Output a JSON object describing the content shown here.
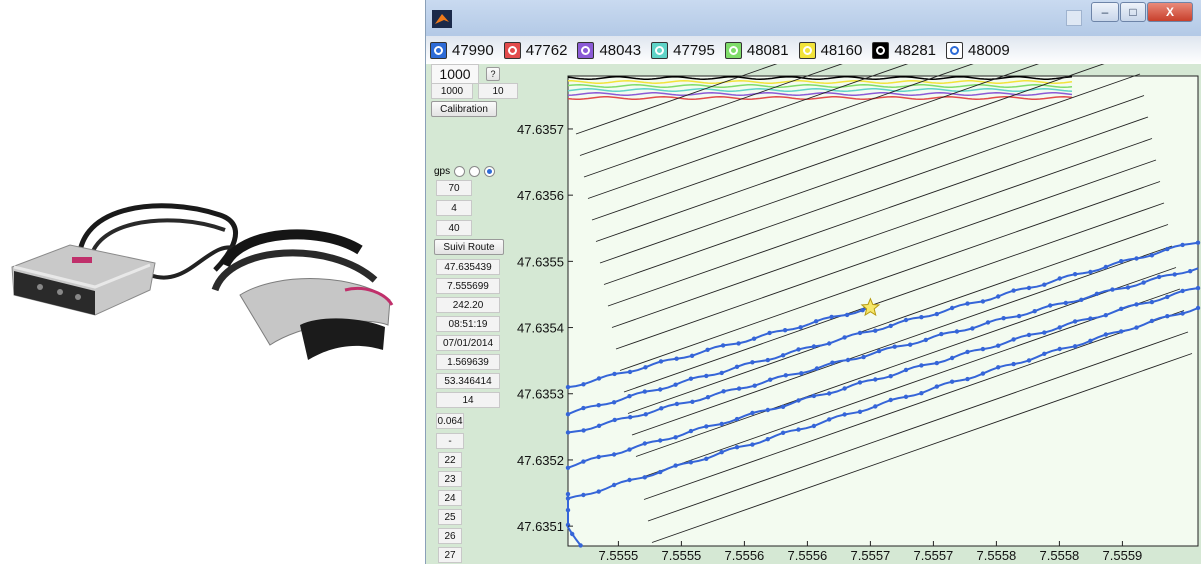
{
  "window": {
    "title": "",
    "buttons": {
      "minimize": "–",
      "maximize": "□",
      "close": "X"
    }
  },
  "legend": [
    {
      "label": "47990",
      "color": "#2d6bd6"
    },
    {
      "label": "47762",
      "color": "#e24b4b"
    },
    {
      "label": "48043",
      "color": "#8b5bd6"
    },
    {
      "label": "47795",
      "color": "#5fd3c7"
    },
    {
      "label": "48081",
      "color": "#7fdc6a"
    },
    {
      "label": "48160",
      "color": "#f2e33a"
    },
    {
      "label": "48281",
      "color": "#000000"
    },
    {
      "label": "48009",
      "color": "#ffffff"
    }
  ],
  "panel": {
    "rate_big": "1000",
    "help": "?",
    "rate": "1000",
    "step": "10",
    "calibration": "Calibration",
    "gps_label": "gps",
    "gps_selected_index": 2,
    "v70": "70",
    "v4": "4",
    "v40": "40",
    "suivi_route": "Suivi Route",
    "values": [
      "47.635439",
      "7.555699",
      "242.20",
      "08:51:19",
      "07/01/2014",
      "1.569639",
      "53.346414",
      "14"
    ],
    "v0064": "0.064",
    "dash": "-",
    "indices": [
      "22",
      "23",
      "24",
      "25",
      "26",
      "27"
    ]
  },
  "chart_data": {
    "type": "line",
    "xlim": [
      7.55543,
      7.55593
    ],
    "ylim": [
      47.63507,
      47.63578
    ],
    "x_ticks": [
      "7.5555",
      "7.5555",
      "7.5556",
      "7.5556",
      "7.5557",
      "7.5557",
      "7.5558",
      "7.5558",
      "7.5559"
    ],
    "x_tick_values": [
      7.55547,
      7.55552,
      7.55557,
      7.55562,
      7.55567,
      7.55572,
      7.55577,
      7.55582,
      7.55587
    ],
    "y_ticks": [
      "47.6351",
      "47.6352",
      "47.6353",
      "47.6354",
      "47.6355",
      "47.6356",
      "47.6357"
    ],
    "y_tick_values": [
      47.6351,
      47.6352,
      47.6353,
      47.6354,
      47.6355,
      47.6356,
      47.6357
    ],
    "marker": {
      "x": 7.55567,
      "y": 47.63543
    },
    "series": [
      {
        "points": [
          [
            7.55543,
            47.63531
          ],
          [
            7.55567,
            47.63543
          ]
        ]
      },
      {
        "points": [
          [
            7.55543,
            47.63527
          ],
          [
            7.55593,
            47.63553
          ]
        ]
      },
      {
        "points": [
          [
            7.55543,
            47.63524
          ],
          [
            7.55593,
            47.63549
          ]
        ]
      },
      {
        "points": [
          [
            7.55543,
            47.63519
          ],
          [
            7.55593,
            47.63546
          ]
        ]
      },
      {
        "points": [
          [
            7.55543,
            47.63514
          ],
          [
            7.55593,
            47.63543
          ]
        ]
      },
      {
        "points": [
          [
            7.55543,
            47.63515
          ],
          [
            7.55543,
            47.6351
          ],
          [
            7.55544,
            47.63507
          ]
        ]
      }
    ]
  }
}
